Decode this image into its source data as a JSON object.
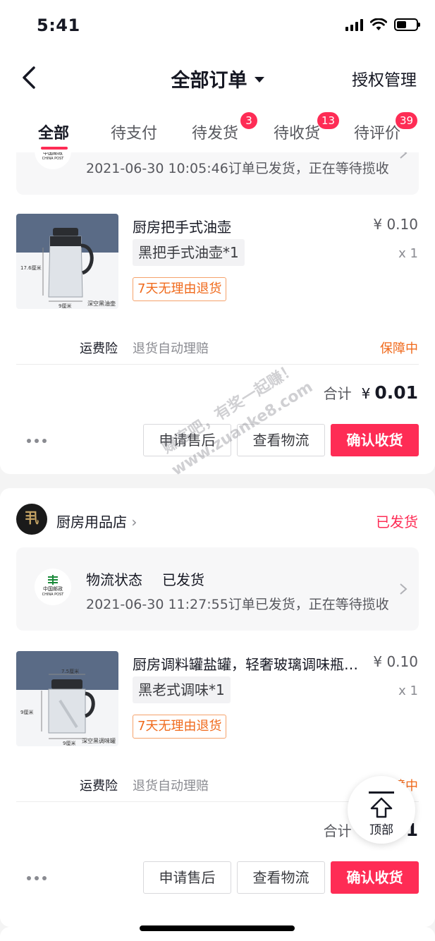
{
  "status_bar": {
    "time": "5:41"
  },
  "header": {
    "back_icon": "chevron-left-icon",
    "title": "全部订单",
    "right_link": "授权管理"
  },
  "tabs": [
    {
      "label": "全部",
      "badge": ""
    },
    {
      "label": "待支付",
      "badge": ""
    },
    {
      "label": "待发货",
      "badge": "3"
    },
    {
      "label": "待收货",
      "badge": "13"
    },
    {
      "label": "待评价",
      "badge": "39"
    }
  ],
  "orders": [
    {
      "logistics": {
        "label": "",
        "state": "",
        "detail": "2021-06-30 10:05:46订单已发货，正在等待揽收"
      },
      "product": {
        "title": "厨房把手式油壶",
        "price": "¥ 0.10",
        "variant": "黑把手式油壶*1",
        "qty": "x 1",
        "tag": "7天无理由退货",
        "image_caption": "深空黑油壶",
        "image_dim_h": "17.6厘米",
        "image_dim_w": "9厘米"
      },
      "insurance": {
        "label": "运费险",
        "desc": "退货自动理赔",
        "status": "保障中"
      },
      "total": {
        "label": "合计",
        "currency": "¥",
        "value": "0.01"
      },
      "buttons": {
        "after_sale": "申请售后",
        "logistics": "查看物流",
        "confirm": "确认收货"
      }
    },
    {
      "shop": {
        "name": "厨房用品店",
        "avatar_text": "丮",
        "status": "已发货"
      },
      "logistics": {
        "label": "物流状态",
        "state": "已发货",
        "detail": "2021-06-30 11:27:55订单已发货，正在等待揽收"
      },
      "product": {
        "title": "厨房调料罐盐罐，轻奢玻璃调味瓶组合套装",
        "price": "¥ 0.10",
        "variant": "黑老式调味*1",
        "qty": "x 1",
        "tag": "7天无理由退货",
        "image_caption": "深空黑调味罐",
        "image_dim_h": "9厘米",
        "image_dim_w": "7.5厘米",
        "image_dim_b": "9厘米"
      },
      "insurance": {
        "label": "运费险",
        "desc": "退货自动理赔",
        "status": "保障中"
      },
      "total": {
        "label": "合计",
        "currency": "¥",
        "value": "0.01"
      },
      "buttons": {
        "after_sale": "申请售后",
        "logistics": "查看物流",
        "confirm": "确认收货"
      }
    }
  ],
  "post_logo": {
    "cn": "中国邮政",
    "en": "CHINA POST"
  },
  "float_button": {
    "label": "顶部"
  },
  "watermark": {
    "line1": "赚客吧，有奖一起赚！",
    "line2": "www.zuanke8.com"
  },
  "colors": {
    "accent": "#fe2c55",
    "orange": "#f06a1c"
  }
}
